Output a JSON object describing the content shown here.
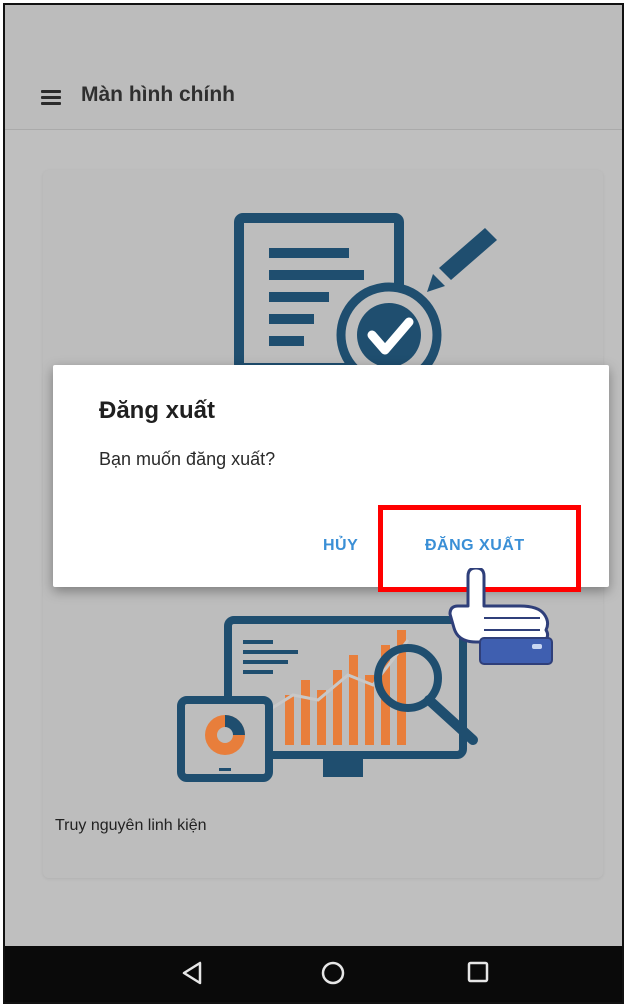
{
  "appbar": {
    "title": "Màn hình chính",
    "menu_icon": "hamburger-menu-icon"
  },
  "card": {
    "caption": "Truy nguyên linh kiện",
    "illustrations": [
      "document-check-icon",
      "analytics-chart-icon"
    ]
  },
  "dialog": {
    "title": "Đăng xuất",
    "message": "Bạn muốn đăng xuất?",
    "cancel_label": "HỦY",
    "confirm_label": "ĐĂNG XUẤT"
  },
  "navbar": {
    "icons": [
      "back-triangle-icon",
      "home-circle-icon",
      "recents-square-icon"
    ]
  },
  "colors": {
    "accent": "#3a8fd6",
    "highlight": "#ff0000",
    "illustration_blue": "#1f4e6f",
    "illustration_orange": "#e87e3b"
  }
}
